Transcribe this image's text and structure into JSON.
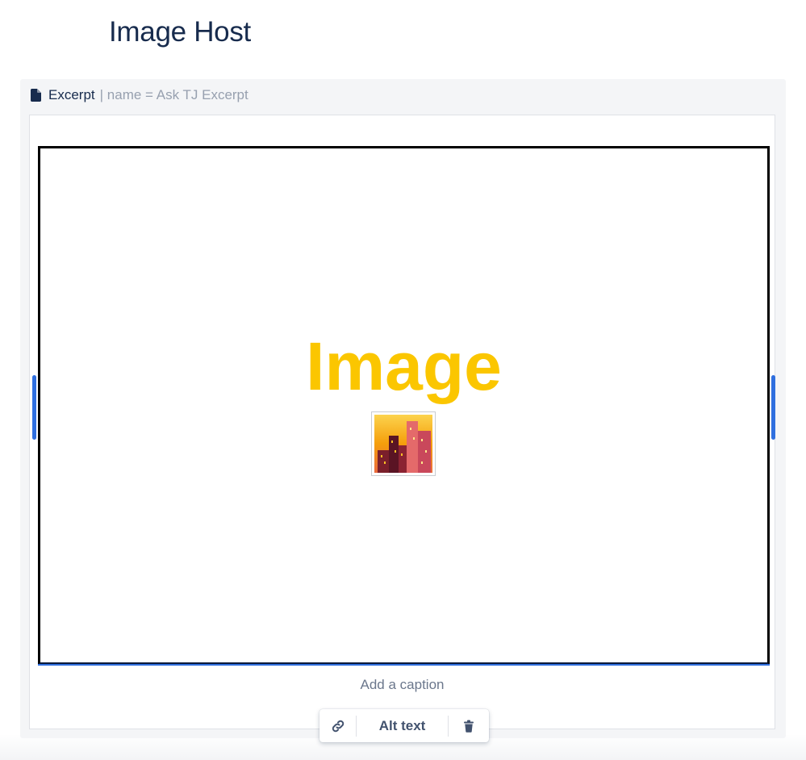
{
  "page": {
    "title": "Image Host"
  },
  "macro": {
    "name": "Excerpt",
    "params": "| name = Ask TJ Excerpt",
    "icon": "document-icon"
  },
  "image": {
    "placeholder_text": "Image",
    "emoji_icon": "cityscape-at-dusk-icon",
    "text_color": "#fbc600"
  },
  "caption": {
    "placeholder": "Add a caption"
  },
  "toolbar": {
    "link_icon": "link-icon",
    "alt_text_label": "Alt text",
    "delete_icon": "trash-icon"
  },
  "colors": {
    "accent": "#2f6fdf",
    "heading": "#172b4d",
    "muted": "#97a0af"
  }
}
